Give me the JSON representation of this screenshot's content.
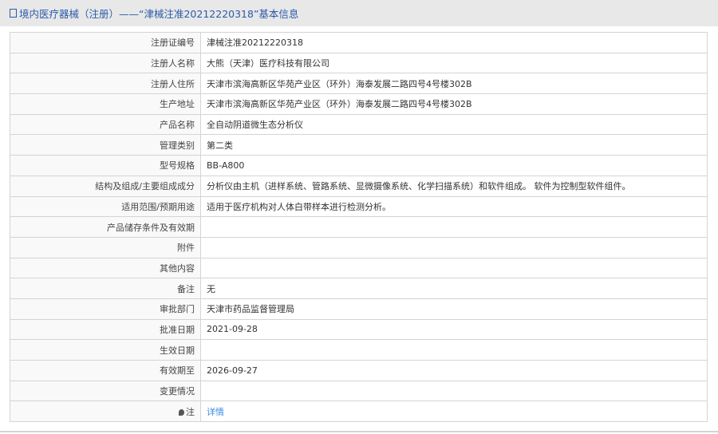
{
  "header": {
    "title": "境内医疗器械（注册）——“津械注准20212220318”基本信息"
  },
  "rows": [
    {
      "label": "注册证编号",
      "value": "津械注准20212220318"
    },
    {
      "label": "注册人名称",
      "value": "大熊（天津）医疗科技有限公司"
    },
    {
      "label": "注册人住所",
      "value": "天津市滨海高新区华苑产业区（环外）海泰发展二路四号4号楼302B"
    },
    {
      "label": "生产地址",
      "value": "天津市滨海高新区华苑产业区（环外）海泰发展二路四号4号楼302B"
    },
    {
      "label": "产品名称",
      "value": "全自动阴道微生态分析仪"
    },
    {
      "label": "管理类别",
      "value": "第二类"
    },
    {
      "label": "型号规格",
      "value": "BB-A800"
    },
    {
      "label": "结构及组成/主要组成成分",
      "value": "分析仪由主机（进样系统、管路系统、显微摄像系统、化学扫描系统）和软件组成。 软件为控制型软件组件。"
    },
    {
      "label": "适用范围/预期用途",
      "value": "适用于医疗机构对人体白带样本进行检测分析。"
    },
    {
      "label": "产品储存条件及有效期",
      "value": ""
    },
    {
      "label": "附件",
      "value": ""
    },
    {
      "label": "其他内容",
      "value": ""
    },
    {
      "label": "备注",
      "value": "无"
    },
    {
      "label": "审批部门",
      "value": "天津市药品监督管理局"
    },
    {
      "label": "批准日期",
      "value": "2021-09-28"
    },
    {
      "label": "生效日期",
      "value": ""
    },
    {
      "label": "有效期至",
      "value": "2026-09-27"
    },
    {
      "label": "变更情况",
      "value": ""
    }
  ],
  "note": {
    "label": "注",
    "link": "详情"
  }
}
